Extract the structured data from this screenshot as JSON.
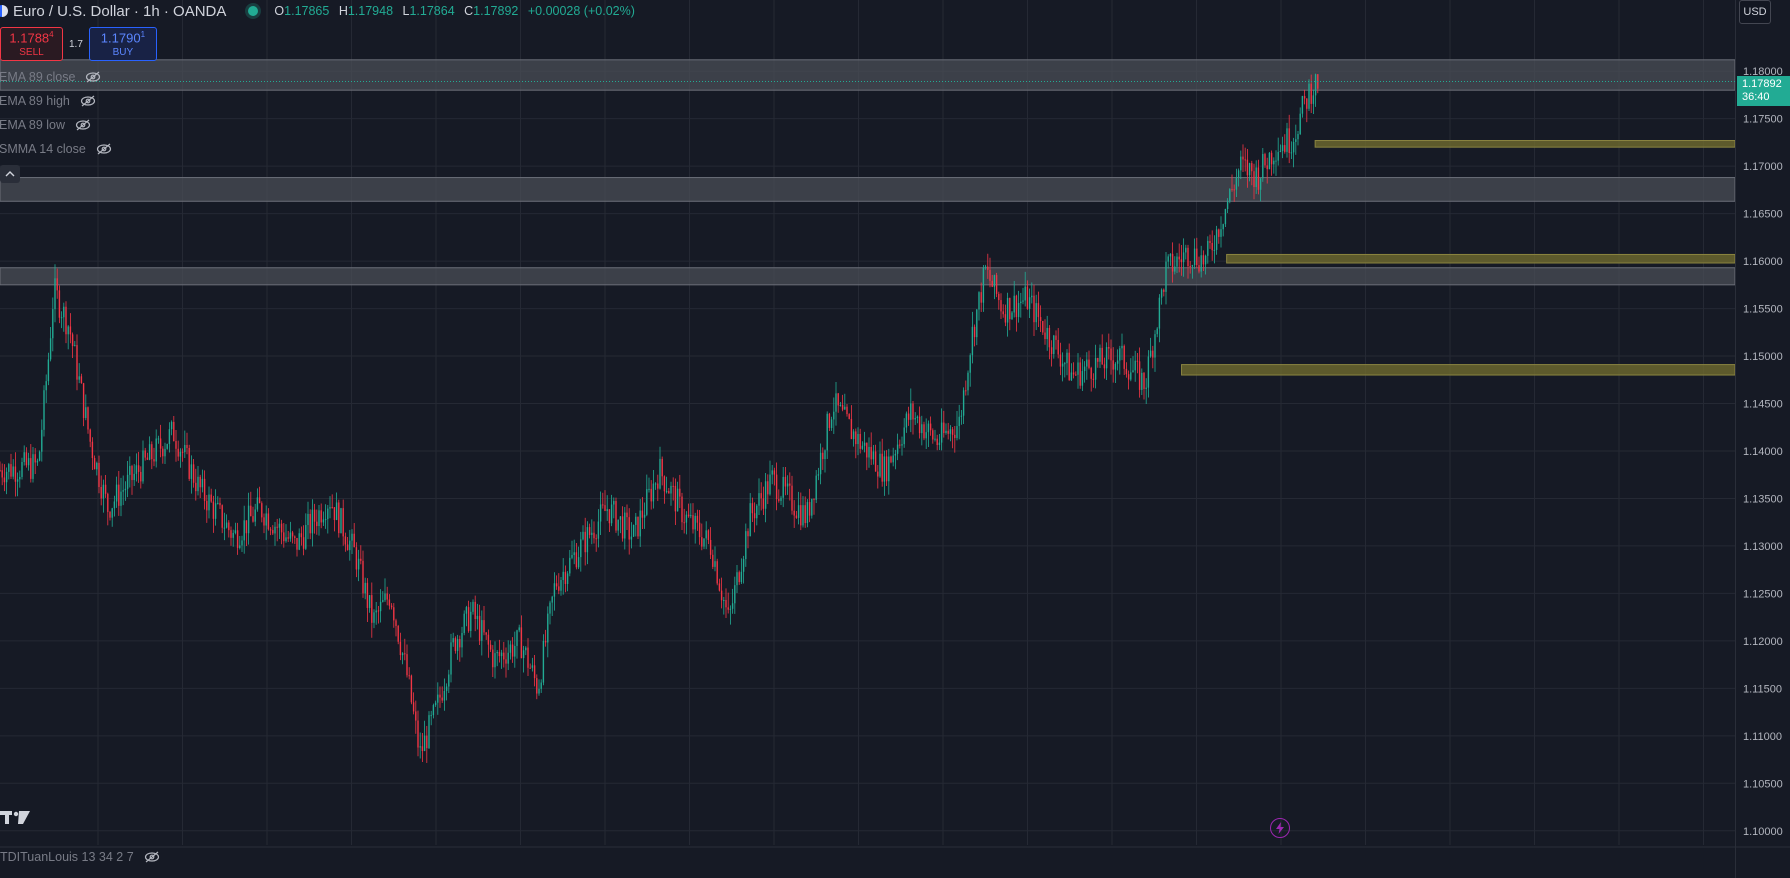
{
  "header": {
    "title": "Euro / U.S. Dollar · 1h · OANDA",
    "ohlc": [
      {
        "key": "O",
        "value": "1.17865"
      },
      {
        "key": "H",
        "value": "1.17948"
      },
      {
        "key": "L",
        "value": "1.17864"
      },
      {
        "key": "C",
        "value": "1.17892"
      }
    ],
    "change": "+0.00028 (+0.02%)"
  },
  "trade": {
    "sell_price": "1.1788",
    "sell_sup": "4",
    "sell_label": "SELL",
    "spread": "1.7",
    "buy_price": "1.1790",
    "buy_sup": "1",
    "buy_label": "BUY"
  },
  "indicators": [
    {
      "name": "EMA 89 close"
    },
    {
      "name": "EMA 89 high"
    },
    {
      "name": "EMA 89 low"
    },
    {
      "name": "SMMA 14 close"
    }
  ],
  "bottom_indicator": "TDITuanLouis 13 34 2 7",
  "currency_button": "USD",
  "last_price": {
    "price": "1.17892",
    "countdown": "36:40"
  },
  "colors": {
    "background": "#161a25",
    "up": "#22ab94",
    "down": "#f23645",
    "zone_gray": "#4a4d56",
    "zone_olive": "#6f6a2e",
    "grid": "#252934",
    "axis_text": "#b2b5be"
  },
  "chart_data": {
    "type": "candlestick",
    "symbol": "EURUSD",
    "timeframe": "1h",
    "y_ticks": [
      1.1,
      1.105,
      1.11,
      1.115,
      1.12,
      1.125,
      1.13,
      1.135,
      1.14,
      1.145,
      1.15,
      1.155,
      1.16,
      1.165,
      1.17,
      1.175,
      1.18
    ],
    "y_tick_labels": [
      "1.10000",
      "1.10500",
      "1.11000",
      "1.11500",
      "1.12000",
      "1.12500",
      "1.13000",
      "1.13500",
      "1.14000",
      "1.14500",
      "1.15000",
      "1.15500",
      "1.16000",
      "1.16500",
      "1.17000",
      "1.17500",
      "1.18000"
    ],
    "ylim": [
      1.0985,
      1.1875
    ],
    "price_path": [
      [
        0,
        1.138
      ],
      [
        0.022,
        1.1385
      ],
      [
        0.028,
        1.15
      ],
      [
        0.031,
        1.157
      ],
      [
        0.04,
        1.153
      ],
      [
        0.052,
        1.141
      ],
      [
        0.062,
        1.134
      ],
      [
        0.08,
        1.138
      ],
      [
        0.1,
        1.142
      ],
      [
        0.115,
        1.136
      ],
      [
        0.135,
        1.131
      ],
      [
        0.15,
        1.134
      ],
      [
        0.17,
        1.13
      ],
      [
        0.19,
        1.135
      ],
      [
        0.205,
        1.129
      ],
      [
        0.215,
        1.122
      ],
      [
        0.225,
        1.125
      ],
      [
        0.235,
        1.116
      ],
      [
        0.242,
        1.108
      ],
      [
        0.252,
        1.113
      ],
      [
        0.262,
        1.12
      ],
      [
        0.272,
        1.123
      ],
      [
        0.285,
        1.118
      ],
      [
        0.3,
        1.12
      ],
      [
        0.31,
        1.115
      ],
      [
        0.32,
        1.126
      ],
      [
        0.335,
        1.13
      ],
      [
        0.35,
        1.134
      ],
      [
        0.365,
        1.131
      ],
      [
        0.38,
        1.138
      ],
      [
        0.395,
        1.133
      ],
      [
        0.41,
        1.13
      ],
      [
        0.42,
        1.122
      ],
      [
        0.432,
        1.133
      ],
      [
        0.445,
        1.137
      ],
      [
        0.465,
        1.133
      ],
      [
        0.48,
        1.145
      ],
      [
        0.495,
        1.141
      ],
      [
        0.51,
        1.138
      ],
      [
        0.525,
        1.144
      ],
      [
        0.54,
        1.141
      ],
      [
        0.553,
        1.143
      ],
      [
        0.56,
        1.152
      ],
      [
        0.568,
        1.159
      ],
      [
        0.578,
        1.155
      ],
      [
        0.592,
        1.156
      ],
      [
        0.605,
        1.152
      ],
      [
        0.618,
        1.148
      ],
      [
        0.63,
        1.149
      ],
      [
        0.645,
        1.15
      ],
      [
        0.66,
        1.147
      ],
      [
        0.672,
        1.159
      ],
      [
        0.685,
        1.161
      ],
      [
        0.695,
        1.16
      ],
      [
        0.705,
        1.165
      ],
      [
        0.715,
        1.17
      ],
      [
        0.725,
        1.169
      ],
      [
        0.735,
        1.172
      ],
      [
        0.745,
        1.173
      ],
      [
        0.755,
        1.178
      ],
      [
        0.76,
        1.17892
      ]
    ],
    "zones": [
      {
        "kind": "gray",
        "from": 1.178,
        "to": 1.1812
      },
      {
        "kind": "gray",
        "from": 1.1663,
        "to": 1.1688
      },
      {
        "kind": "gray",
        "from": 1.1575,
        "to": 1.1593
      },
      {
        "kind": "olive",
        "from": 1.172,
        "to": 1.1727,
        "start": 0.758
      },
      {
        "kind": "olive",
        "from": 1.1598,
        "to": 1.1607,
        "start": 0.707
      },
      {
        "kind": "olive",
        "from": 1.148,
        "to": 1.1491,
        "start": 0.681
      }
    ],
    "last_price": 1.17892,
    "grid": true
  }
}
